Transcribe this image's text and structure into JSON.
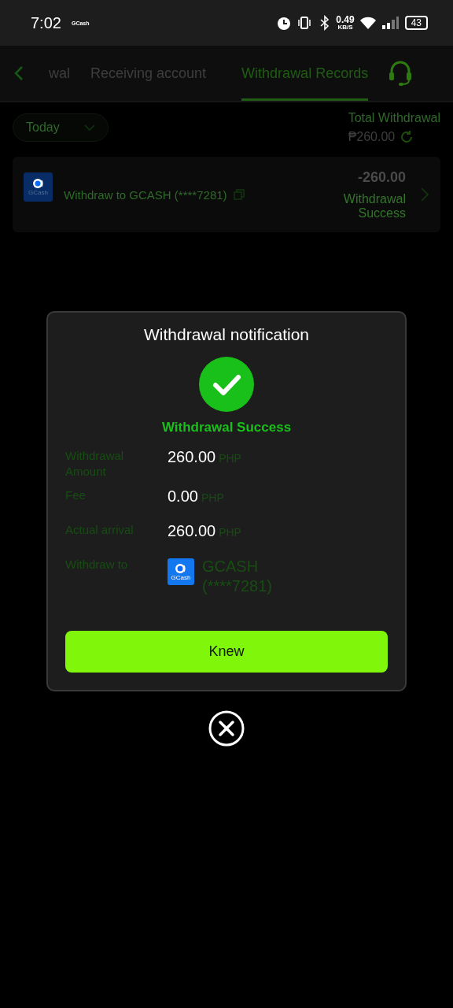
{
  "status_bar": {
    "time": "7:02",
    "notification": "GCash",
    "speed_value": "0.49",
    "speed_unit": "KB/S",
    "battery": "43"
  },
  "header": {
    "tabs": [
      {
        "label": "wal",
        "selected": false
      },
      {
        "label": "Receiving account",
        "selected": false
      },
      {
        "label": "Withdrawal Records",
        "selected": true
      }
    ]
  },
  "filter": {
    "label": "Today"
  },
  "total": {
    "label": "Total Withdrawal",
    "amount": "₱260.00"
  },
  "records": [
    {
      "title": "Withdraw to GCASH (****7281)",
      "logo_text": "GCash",
      "amount": "-260.00",
      "status": "Withdrawal Success"
    }
  ],
  "dialog": {
    "title": "Withdrawal notification",
    "status": "Withdrawal Success",
    "rows": [
      {
        "kind": "amount",
        "label": "Withdrawal Amount",
        "value": "260.00",
        "unit": "PHP"
      },
      {
        "kind": "amount",
        "label": "Fee",
        "value": "0.00",
        "unit": "PHP"
      },
      {
        "kind": "amount",
        "label": "Actual arrival",
        "value": "260.00",
        "unit": "PHP"
      },
      {
        "kind": "account",
        "label": "Withdraw to",
        "logo_text": "GCash",
        "value": "GCASH (****7281)"
      }
    ],
    "button": "Knew"
  }
}
